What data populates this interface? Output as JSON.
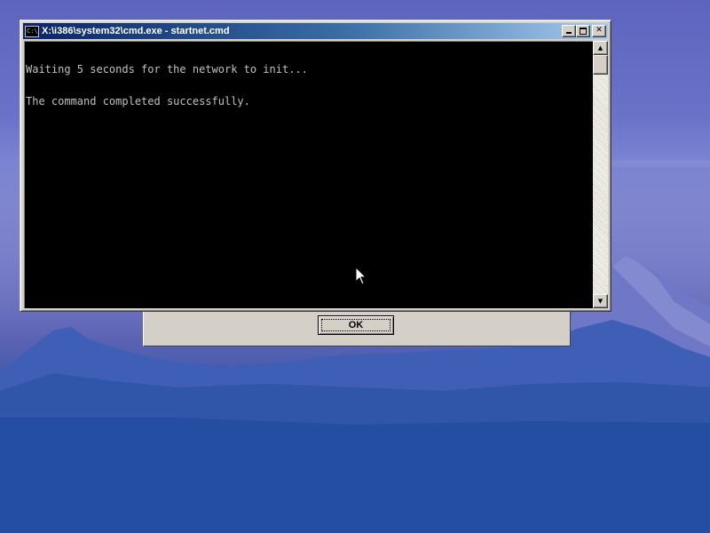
{
  "window": {
    "title": "X:\\i386\\system32\\cmd.exe - startnet.cmd",
    "icon": "cmd-icon",
    "icon_text": "C:\\",
    "buttons": {
      "minimize": "minimize-icon",
      "maximize": "maximize-icon",
      "close": "✕"
    }
  },
  "console": {
    "lines": [
      "Waiting 5 seconds for the network to init...",
      "The command completed successfully."
    ],
    "text_color": "#c0c0c0",
    "background": "#000000"
  },
  "scrollbar": {
    "up": "▲",
    "down": "▼"
  },
  "dialog": {
    "ok_label": "OK"
  },
  "pointer": "mouse-pointer-icon"
}
